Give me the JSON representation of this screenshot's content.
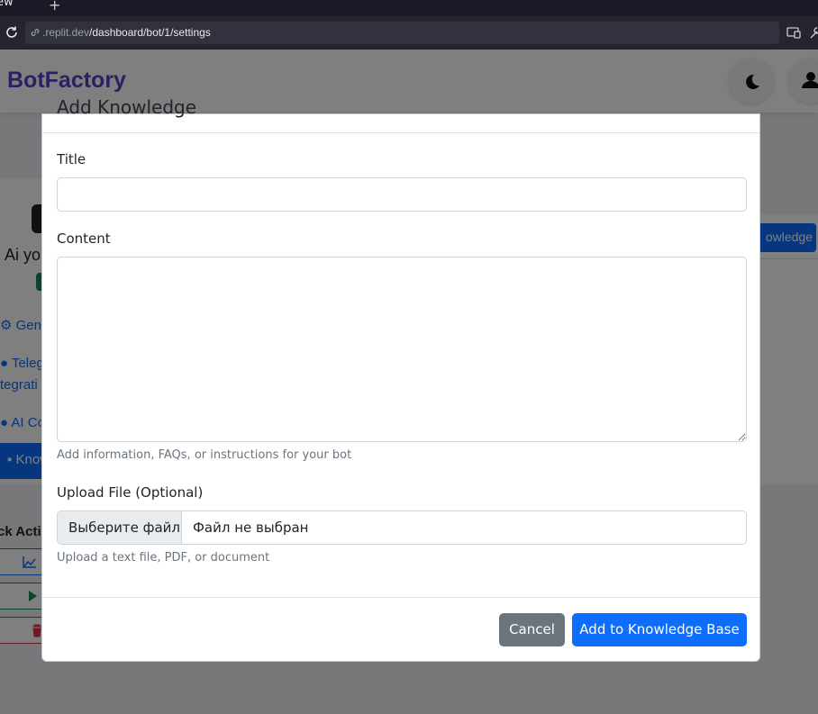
{
  "browser": {
    "tab_label": "ew",
    "new_tab_symbol": "+",
    "url_prefix": ".replit.dev",
    "url_path": "/dashboard/bot/1/settings"
  },
  "navbar": {
    "brand": "BotFactory",
    "theme_icon": "moon-icon",
    "user_icon": "user-icon"
  },
  "background": {
    "bot_name": "Ai yo",
    "sidebar": {
      "general": "Gene",
      "telegram_line1": "Teleg",
      "telegram_line2": "tegrati",
      "ai_config": "AI Co",
      "knowledge": "Know"
    },
    "quick_actions_title": "ck Actio",
    "knowledge_button": "owledge"
  },
  "modal": {
    "title": "Add Knowledge",
    "title_label": "Title",
    "title_value": "",
    "content_label": "Content",
    "content_value": "",
    "content_help": "Add information, FAQs, or instructions for your bot",
    "upload_label": "Upload File (Optional)",
    "file_button": "Выберите файл",
    "file_status": "Файл не выбран",
    "upload_help": "Upload a text file, PDF, or document",
    "cancel_label": "Cancel",
    "submit_label": "Add to Knowledge Base"
  },
  "colors": {
    "brand": "#5b3fc7",
    "primary": "#0d6efd",
    "secondary": "#6c757d",
    "success": "#198754",
    "danger": "#dc3545"
  }
}
